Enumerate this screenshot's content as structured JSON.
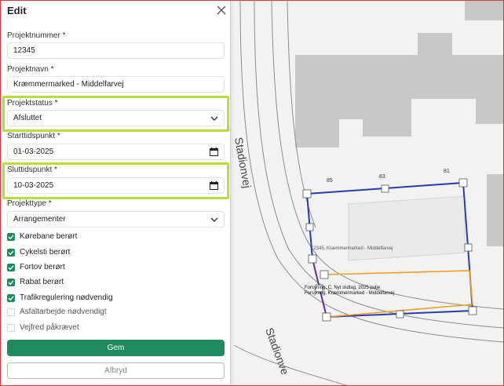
{
  "panel": {
    "title": "Edit",
    "fields": {
      "projektnummer": {
        "label": "Projektnummer *",
        "value": "12345"
      },
      "projektnavn": {
        "label": "Projektnavn *",
        "value": "Kræmmermarked - Middelfarvej"
      },
      "projektstatus": {
        "label": "Projektstatus *",
        "value": "Afsluttet"
      },
      "starttidspunkt": {
        "label": "Starttidspunkt *",
        "value": "01-03-2025"
      },
      "sluttidspunkt": {
        "label": "Sluttidspunkt *",
        "value": "10-03-2025"
      },
      "projekttype": {
        "label": "Projekttype *",
        "value": "Arrangementer"
      }
    },
    "checkboxes": [
      {
        "label": "Kørebane berørt",
        "checked": true
      },
      {
        "label": "Cykelsti berørt",
        "checked": true
      },
      {
        "label": "Fortov berørt",
        "checked": true
      },
      {
        "label": "Rabat berørt",
        "checked": true
      },
      {
        "label": "Trafikregulering nødvendig",
        "checked": true
      },
      {
        "label": "Asfaltarbejde nødvendigt",
        "checked": false
      },
      {
        "label": "Vejfred påkrævet",
        "checked": false
      }
    ],
    "save_label": "Gem",
    "cancel_label": "Afbryd"
  },
  "map": {
    "street_names": [
      "Stadionvej",
      "Stadionve"
    ],
    "house_numbers": [
      "85",
      "83",
      "81"
    ],
    "project_label": "12345, Kræmmermarked - Middelfarvej",
    "overlap_label_1": "Forsyning, C, Nyt slidlag, 2025 pulje",
    "overlap_label_2": "Forsyning, Kræmmermarked - Middelfarvej",
    "colors": {
      "project_line": "#2a3bb0",
      "overlap_line": "#f0a020",
      "building": "#c8c8c8",
      "highlight": "#b8dc39",
      "save_button": "#1e8a5d"
    }
  }
}
